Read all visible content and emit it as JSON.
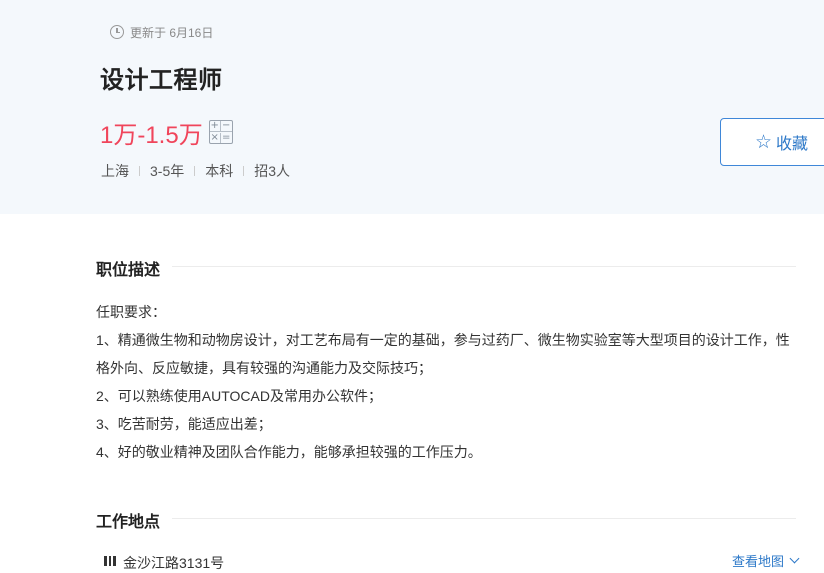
{
  "header": {
    "updated": "更新于 6月16日",
    "title": "设计工程师",
    "salary": "1万-1.5万",
    "calc_symbols": [
      "+",
      "−",
      "×",
      "="
    ],
    "tags": [
      "上海",
      "3-5年",
      "本科",
      "招3人"
    ],
    "favorite_label": "收藏"
  },
  "description": {
    "heading": "职位描述",
    "lines": [
      "任职要求：",
      "1、精通微生物和动物房设计，对工艺布局有一定的基础，参与过药厂、微生物实验室等大型项目的设计工作，性格外向、反应敏捷，具有较强的沟通能力及交际技巧；",
      "2、可以熟练使用AUTOCAD及常用办公软件；",
      "3、吃苦耐劳，能适应出差；",
      "4、好的敬业精神及团队合作能力，能够承担较强的工作压力。"
    ]
  },
  "location": {
    "heading": "工作地点",
    "address": "金沙江路3131号",
    "map_link": "查看地图"
  },
  "colors": {
    "salary": "#f0455b",
    "accent": "#2c78c8",
    "header_bg": "#f4f8fc"
  }
}
